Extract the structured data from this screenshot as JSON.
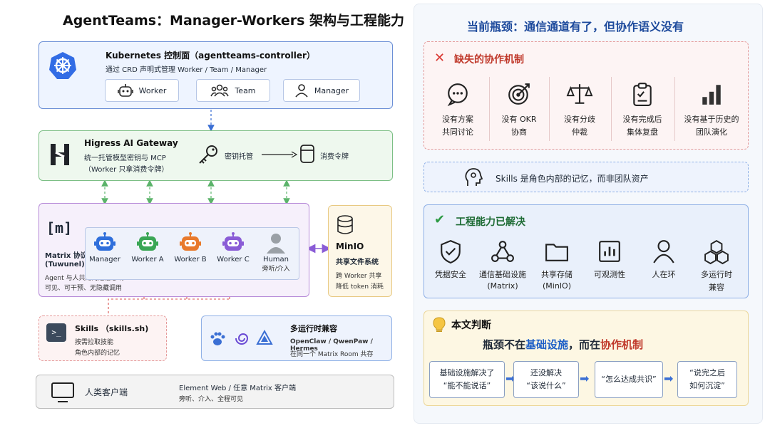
{
  "left": {
    "title": "AgentTeams：Manager-Workers 架构与工程能力",
    "controller": {
      "title": "Kubernetes 控制面（agentteams-controller）",
      "desc": "通过 CRD 声明式管理 Worker / Team / Manager",
      "chips": [
        "Worker",
        "Team",
        "Manager"
      ]
    },
    "gateway": {
      "title": "Higress AI Gateway",
      "desc1": "统一托管模型密钥与 MCP",
      "desc2": "（Worker 只拿消费令牌）",
      "key_label": "密钥托管",
      "token_label": "消费令牌"
    },
    "matrix": {
      "logo": "[m]",
      "name1": "Matrix 协议",
      "name2": "(Tuwunel)",
      "desc1": "Agent 与人共用的通信总线",
      "desc2": "可见、可干预、无隐藏调用",
      "agents": [
        "Manager",
        "Worker A",
        "Worker B",
        "Worker C"
      ],
      "human": "Human",
      "human_sub": "旁听/介入",
      "agent_colors": [
        "#2f6fdb",
        "#3aa655",
        "#e8792b",
        "#8a5cd6"
      ]
    },
    "minio": {
      "title": "MinIO",
      "sub": "共享文件系统",
      "desc1": "跨 Worker 共享",
      "desc2": "降低 token 消耗"
    },
    "skills": {
      "title": "Skills （skills.sh)",
      "desc1": "按需拉取技能",
      "desc2": "角色内部的记忆"
    },
    "runtime": {
      "title": "多运行时兼容",
      "desc1": "OpenClaw / QwenPaw / Hermes",
      "desc2": "在同一个 Matrix Room 共存"
    },
    "client": {
      "title": "人类客户端",
      "desc1": "Element Web / 任意 Matrix 客户端",
      "desc2": "旁听、介入、全程可见"
    }
  },
  "right": {
    "title": "当前瓶颈：通信通道有了，但协作语义没有",
    "missing": {
      "title": "缺失的协作机制",
      "items": [
        {
          "icon": "chat-icon",
          "l1": "没有方案",
          "l2": "共同讨论"
        },
        {
          "icon": "target-icon",
          "l1": "没有 OKR",
          "l2": "协商"
        },
        {
          "icon": "scale-icon",
          "l1": "没有分歧",
          "l2": "仲裁"
        },
        {
          "icon": "clipboard-icon",
          "l1": "没有完成后",
          "l2": "集体复盘"
        },
        {
          "icon": "bar-chart-icon",
          "l1": "没有基于历史的",
          "l2": "团队演化"
        }
      ]
    },
    "skills_note": "Skills 是角色内部的记忆，而非团队资产",
    "solved": {
      "title": "工程能力已解决",
      "items": [
        {
          "icon": "shield-icon",
          "l1": "凭据安全",
          "l2": ""
        },
        {
          "icon": "network-icon",
          "l1": "通信基础设施",
          "l2": "(Matrix)"
        },
        {
          "icon": "folder-icon",
          "l1": "共享存储",
          "l2": "(MinIO)"
        },
        {
          "icon": "chart-icon",
          "l1": "可观测性",
          "l2": ""
        },
        {
          "icon": "person-icon",
          "l1": "人在环",
          "l2": ""
        },
        {
          "icon": "cubes-icon",
          "l1": "多运行时",
          "l2": "兼容"
        }
      ]
    },
    "judgement": {
      "title": "本文判断",
      "headline_a": "瓶颈不在",
      "headline_b": "基础设施",
      "headline_c": "，而在",
      "headline_d": "协作机制",
      "flow": [
        {
          "l1": "基础设施解决了",
          "l2": "“能不能说话”"
        },
        {
          "l1": "还没解决",
          "l2": "“该说什么”"
        },
        {
          "l1": "“怎么达成共识”",
          "l2": ""
        },
        {
          "l1": "“说完之后",
          "l2": "如何沉淀”"
        }
      ]
    }
  }
}
